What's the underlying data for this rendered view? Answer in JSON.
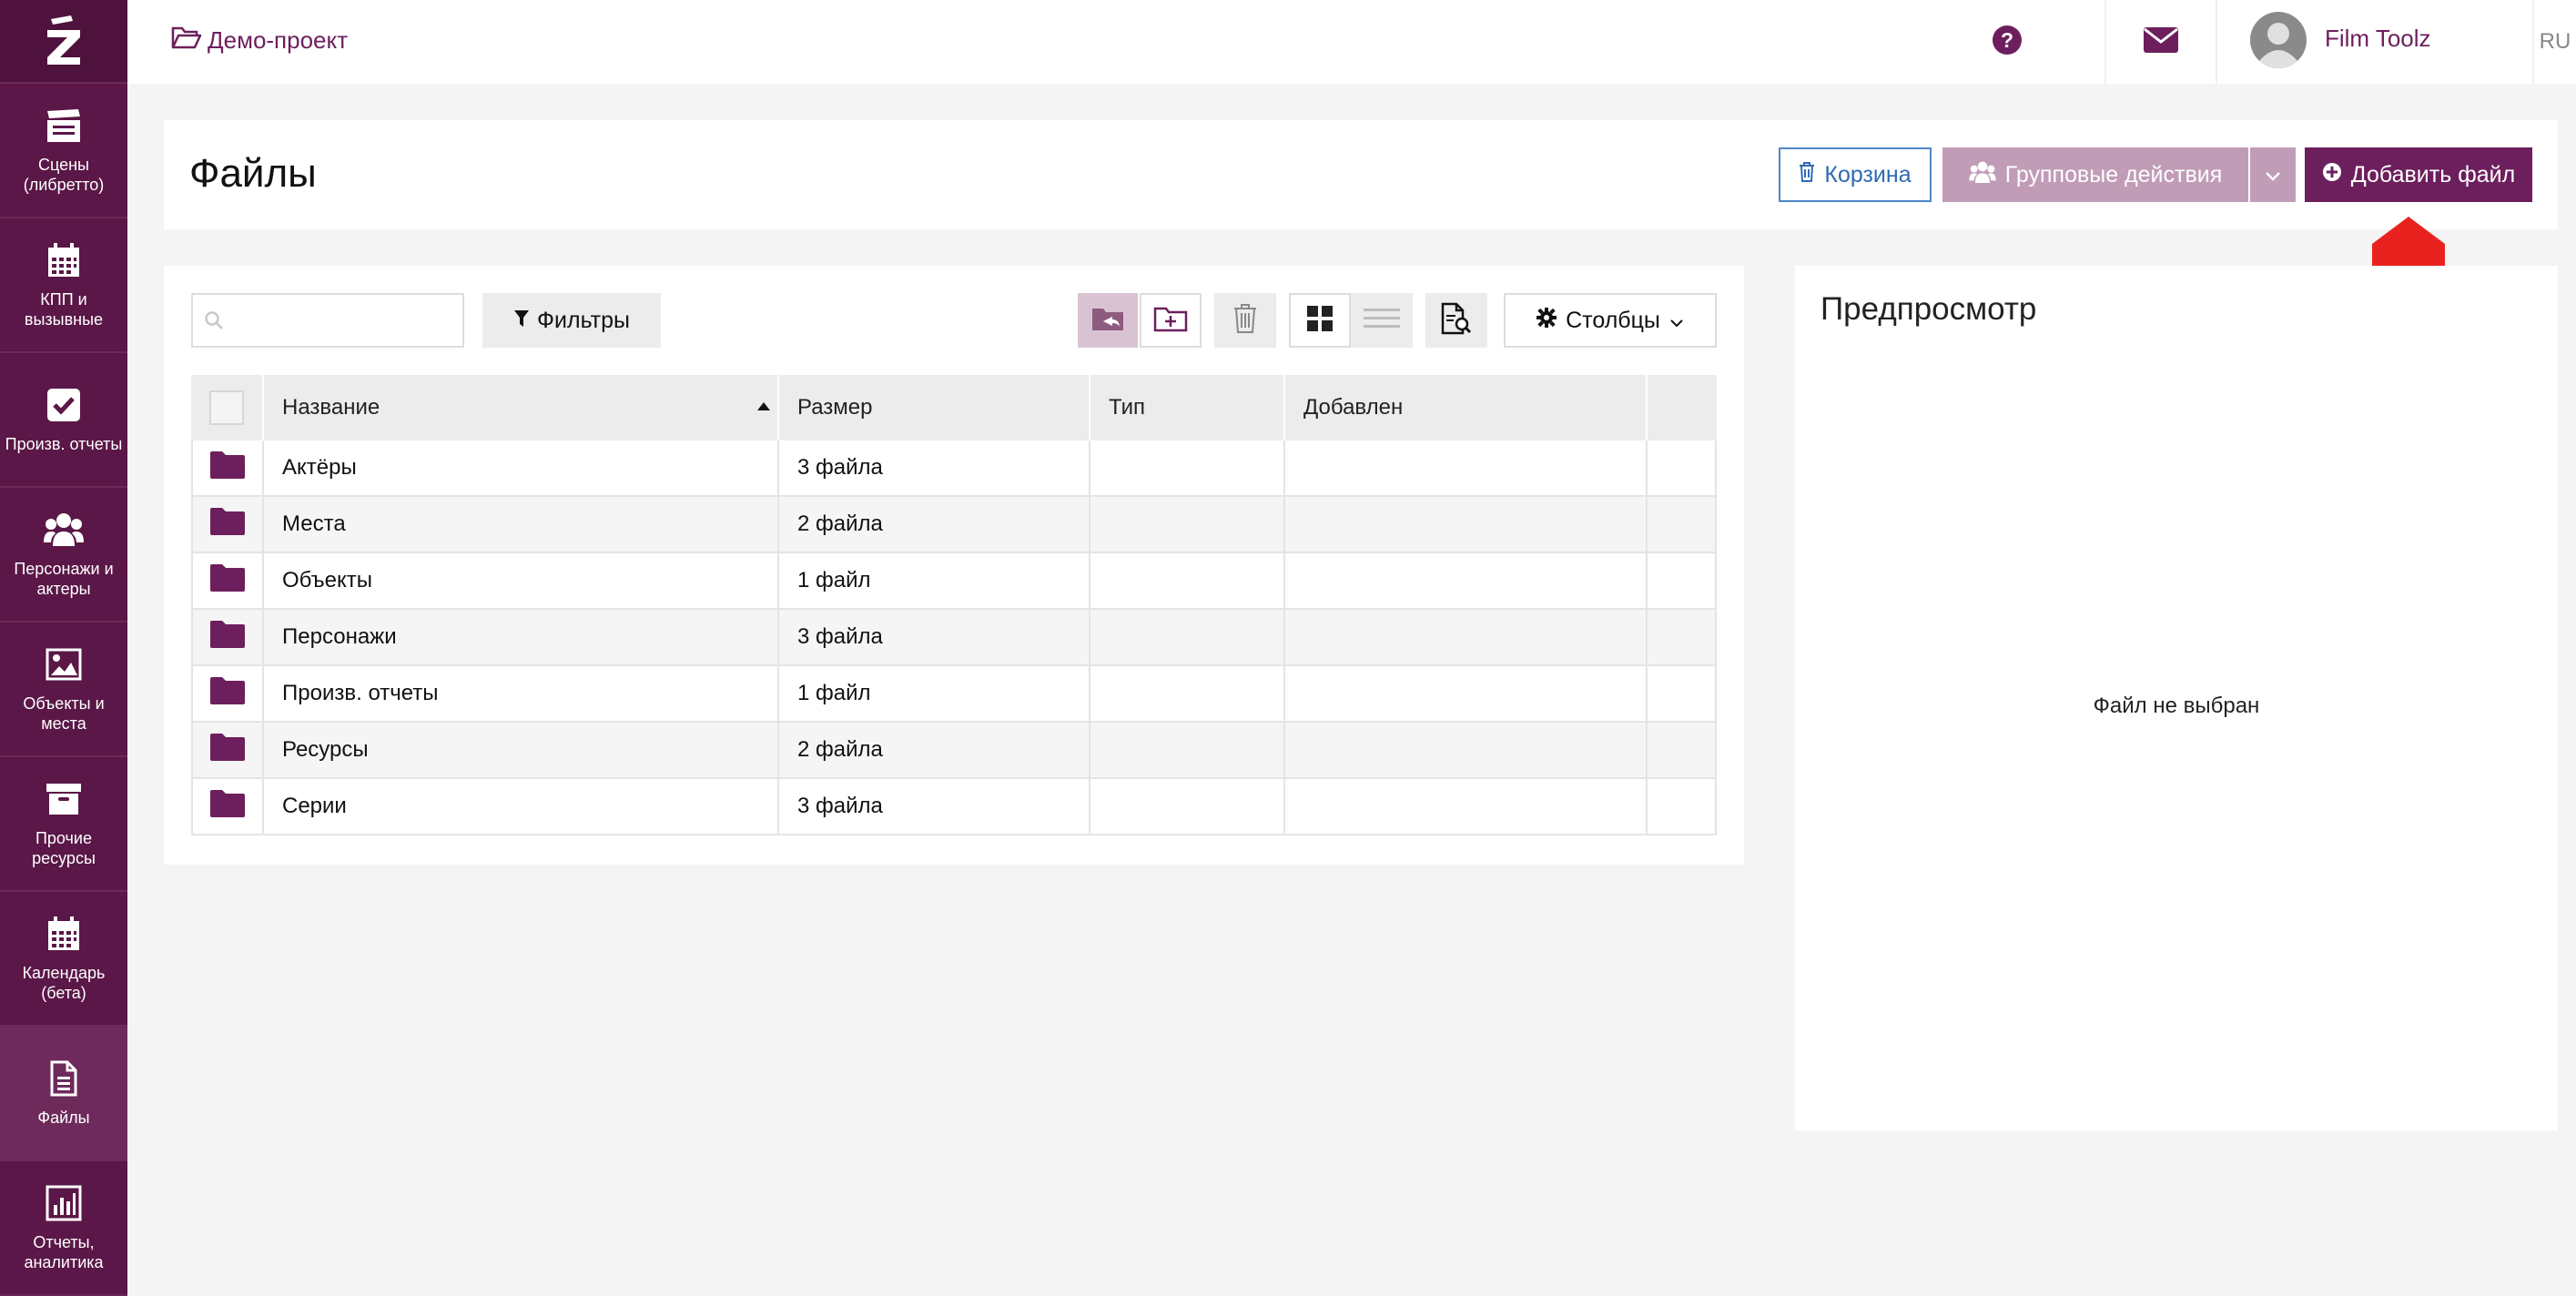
{
  "sidebar": {
    "logo": "Z",
    "items": [
      {
        "label": "Сцены (либретто)",
        "icon": "clapperboard-icon"
      },
      {
        "label": "КПП и вызывные",
        "icon": "calendar-icon"
      },
      {
        "label": "Произв. отчеты",
        "icon": "checkbox-icon"
      },
      {
        "label": "Персонажи и актеры",
        "icon": "users-icon"
      },
      {
        "label": "Объекты и места",
        "icon": "image-icon"
      },
      {
        "label": "Прочие ресурсы",
        "icon": "archive-box-icon"
      },
      {
        "label": "Календарь (бета)",
        "icon": "calendar-icon"
      },
      {
        "label": "Файлы",
        "icon": "file-icon"
      },
      {
        "label": "Отчеты, аналитика",
        "icon": "bar-chart-icon"
      }
    ]
  },
  "topbar": {
    "project": "Демо-проект",
    "user_name": "Film Toolz",
    "lang": "RU"
  },
  "header": {
    "title": "Файлы",
    "trash_label": "Корзина",
    "group_label": "Групповые действия",
    "add_label": "Добавить файл"
  },
  "toolbar": {
    "search_placeholder": "",
    "filter_label": "Фильтры",
    "columns_label": "Столбцы"
  },
  "table": {
    "columns": [
      "Название",
      "Размер",
      "Тип",
      "Добавлен"
    ],
    "rows": [
      {
        "name": "Актёры",
        "size": "3 файла",
        "type": "",
        "added": ""
      },
      {
        "name": "Места",
        "size": "2 файла",
        "type": "",
        "added": ""
      },
      {
        "name": "Объекты",
        "size": "1 файл",
        "type": "",
        "added": ""
      },
      {
        "name": "Персонажи",
        "size": "3 файла",
        "type": "",
        "added": ""
      },
      {
        "name": "Произв. отчеты",
        "size": "1 файл",
        "type": "",
        "added": ""
      },
      {
        "name": "Ресурсы",
        "size": "2 файла",
        "type": "",
        "added": ""
      },
      {
        "name": "Серии",
        "size": "3 файла",
        "type": "",
        "added": ""
      }
    ]
  },
  "preview": {
    "title": "Предпросмотр",
    "empty_text": "Файл не выбран"
  },
  "colors": {
    "brand": "#6d1f5d",
    "sidebar": "#5a1747",
    "trash_blue": "#2f6ab3",
    "group_disabled": "#c19cb7",
    "arrow_red": "#e8231f"
  }
}
